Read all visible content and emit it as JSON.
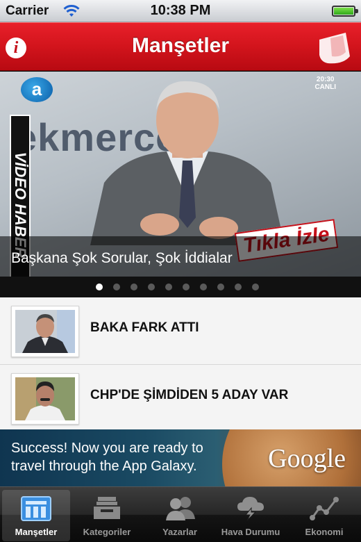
{
  "status_bar": {
    "carrier": "Carrier",
    "time": "10:38 PM"
  },
  "nav_bar": {
    "title": "Manşetler",
    "info_glyph": "i"
  },
  "hero": {
    "backdrop_text": "ekmerce",
    "channel_logo": "a",
    "live_tag": "20:30\nCANLI",
    "side_banner": "VİDEO HABER",
    "badge": "Tıkla İzle",
    "caption": "Başkana Şok Sorular, Şok İddialar",
    "page_count": 10,
    "active_page": 0
  },
  "news": [
    {
      "headline": "BAKA FARK ATTI"
    },
    {
      "headline": "CHP'DE ŞİMDİDEN 5 ADAY VAR"
    }
  ],
  "ad": {
    "line1": "Success! Now you are ready to",
    "line2": "travel through the App Galaxy.",
    "brand": "Google"
  },
  "tabs": [
    {
      "label": "Manşetler",
      "icon": "newspaper-icon",
      "active": true
    },
    {
      "label": "Kategoriler",
      "icon": "inbox-tray-icon",
      "active": false
    },
    {
      "label": "Yazarlar",
      "icon": "people-icon",
      "active": false
    },
    {
      "label": "Hava Durumu",
      "icon": "weather-cloud-icon",
      "active": false
    },
    {
      "label": "Ekonomi",
      "icon": "line-graph-icon",
      "active": false
    }
  ],
  "colors": {
    "brand_red": "#d2141c",
    "tab_bar": "#1a1a1a",
    "list_bg": "#f4f4f4"
  }
}
